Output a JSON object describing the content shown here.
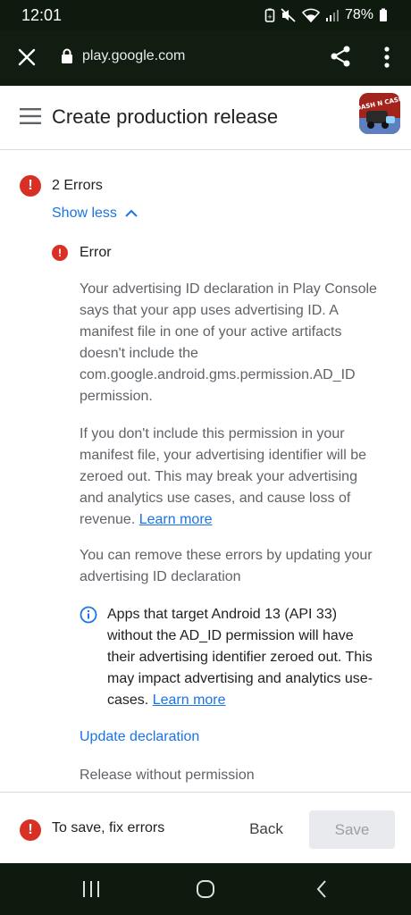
{
  "status_bar": {
    "time": "12:01",
    "battery": "78%"
  },
  "browser": {
    "url": "play.google.com"
  },
  "header": {
    "title": "Create production release",
    "app_icon_label": "DASH N CASH"
  },
  "errors": {
    "summary_label": "2 Errors",
    "toggle_label": "Show less",
    "item_title": "Error",
    "paragraph_1": "Your advertising ID declaration in Play Console says that your app uses advertising ID. A manifest file in one of your active artifacts doesn't include the com.google.android.gms.permission.AD_ID permission.",
    "paragraph_2": "If you don't include this permission in your manifest file, your advertising identifier will be zeroed out. This may break your advertising and analytics use cases, and cause loss of revenue.",
    "paragraph_2_link": "Learn more",
    "paragraph_3": "You can remove these errors by updating your advertising ID declaration",
    "info_text": "Apps that target Android 13 (API 33) without the AD_ID permission will have their advertising identifier zeroed out. This may impact advertising and analytics use-cases.",
    "info_link": "Learn more",
    "update_link": "Update declaration",
    "release_option": "Release without permission"
  },
  "footer": {
    "message": "To save, fix errors",
    "back_label": "Back",
    "save_label": "Save"
  },
  "colors": {
    "error": "#d93025",
    "link": "#1a73e8",
    "system_bar": "#0f1a0f"
  },
  "icons": [
    "close-icon",
    "lock-icon",
    "share-icon",
    "more-vert-icon",
    "menu-icon",
    "error-icon",
    "chevron-up-icon",
    "info-icon",
    "recents-icon",
    "home-icon",
    "back-icon"
  ]
}
